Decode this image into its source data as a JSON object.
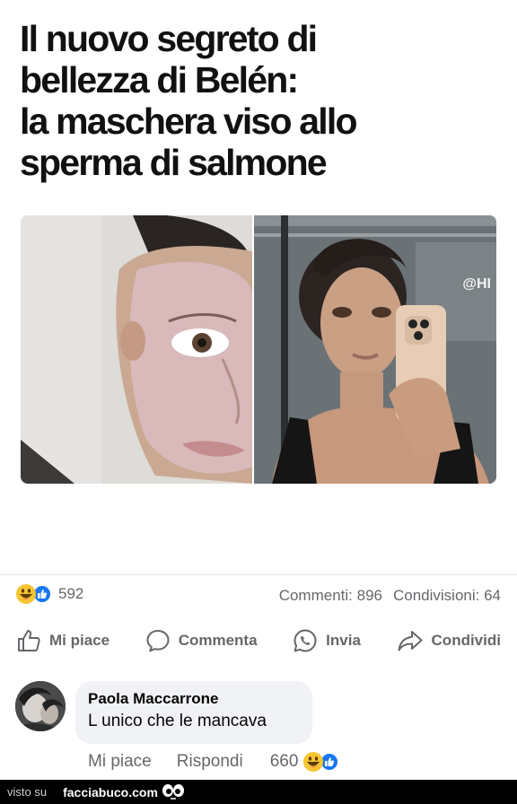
{
  "headline": {
    "lines": [
      "Il nuovo segreto di",
      "bellezza di Belén:",
      "la maschera viso allo",
      "sperma di salmone"
    ]
  },
  "photo": {
    "watermark": "@HI"
  },
  "reactions": {
    "count": "592",
    "icons": [
      "laugh-emoji",
      "like-icon"
    ]
  },
  "stats": {
    "comments": "Commenti: 896",
    "shares": "Condivisioni: 64"
  },
  "actions": {
    "like": "Mi piace",
    "comment": "Commenta",
    "send": "Invia",
    "share": "Condividi"
  },
  "comment": {
    "author": "Paola Maccarrone",
    "text": "L unico che le mancava",
    "like_label": "Mi piace",
    "reply_label": "Rispondi",
    "reaction_count": "660"
  },
  "footer": {
    "visto": "visto su",
    "site": "facciabuco.com"
  },
  "colors": {
    "facebook_blue": "#1877f2",
    "secondary_text": "#65676b",
    "bubble_bg": "#f0f2f5",
    "emoji_yellow": "#f7c531"
  }
}
